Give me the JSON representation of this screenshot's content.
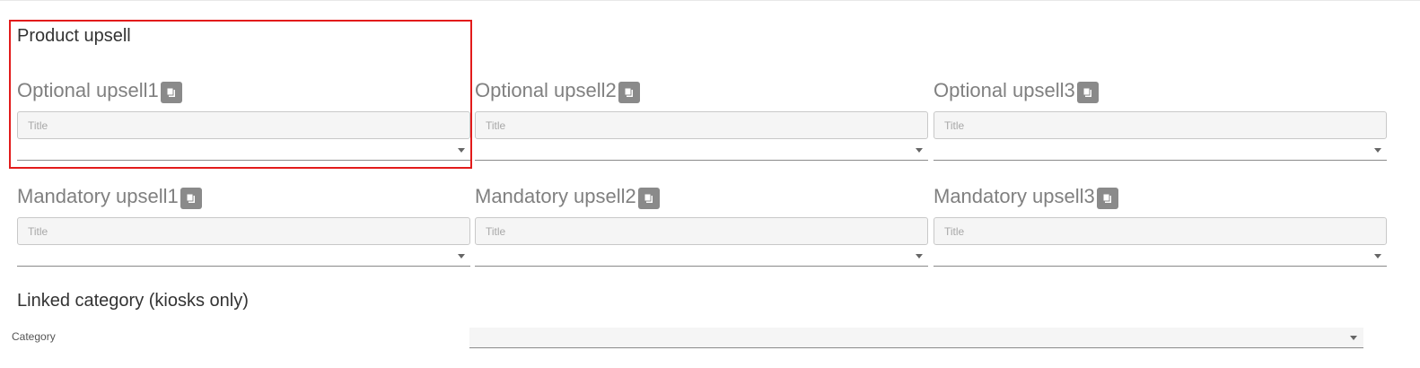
{
  "product_upsell": {
    "title": "Product upsell",
    "optional": [
      {
        "label": "Optional upsell1",
        "placeholder": "Title",
        "select_value": ""
      },
      {
        "label": "Optional upsell2",
        "placeholder": "Title",
        "select_value": ""
      },
      {
        "label": "Optional upsell3",
        "placeholder": "Title",
        "select_value": ""
      }
    ],
    "mandatory": [
      {
        "label": "Mandatory upsell1",
        "placeholder": "Title",
        "select_value": ""
      },
      {
        "label": "Mandatory upsell2",
        "placeholder": "Title",
        "select_value": ""
      },
      {
        "label": "Mandatory upsell3",
        "placeholder": "Title",
        "select_value": ""
      }
    ]
  },
  "linked_category": {
    "title": "Linked category (kiosks only)",
    "category_label": "Category",
    "select_value": ""
  },
  "icons": {
    "copy": "copy-icon",
    "dropdown": "caret-down-icon"
  },
  "colors": {
    "highlight": "#e21b1b",
    "label_gray": "#808080",
    "button_gray": "#8a8a8a"
  }
}
